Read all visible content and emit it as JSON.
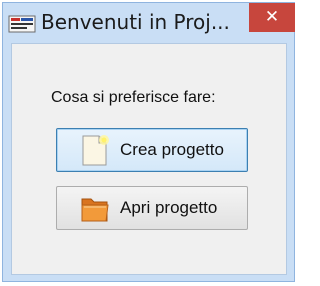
{
  "window": {
    "title": "Benvenuti in Proj...",
    "close_label": "✕"
  },
  "dialog": {
    "prompt": "Cosa si preferisce fare:",
    "create_label": "Crea progetto",
    "open_label": "Apri progetto"
  },
  "icons": {
    "app": "project-app-icon",
    "create": "new-document-icon",
    "open": "folder-icon"
  },
  "colors": {
    "title_bar": "#c9def5",
    "close_button": "#c7463d",
    "client_background": "#f0f0f0",
    "focused_button_border": "#3c7fb1"
  }
}
